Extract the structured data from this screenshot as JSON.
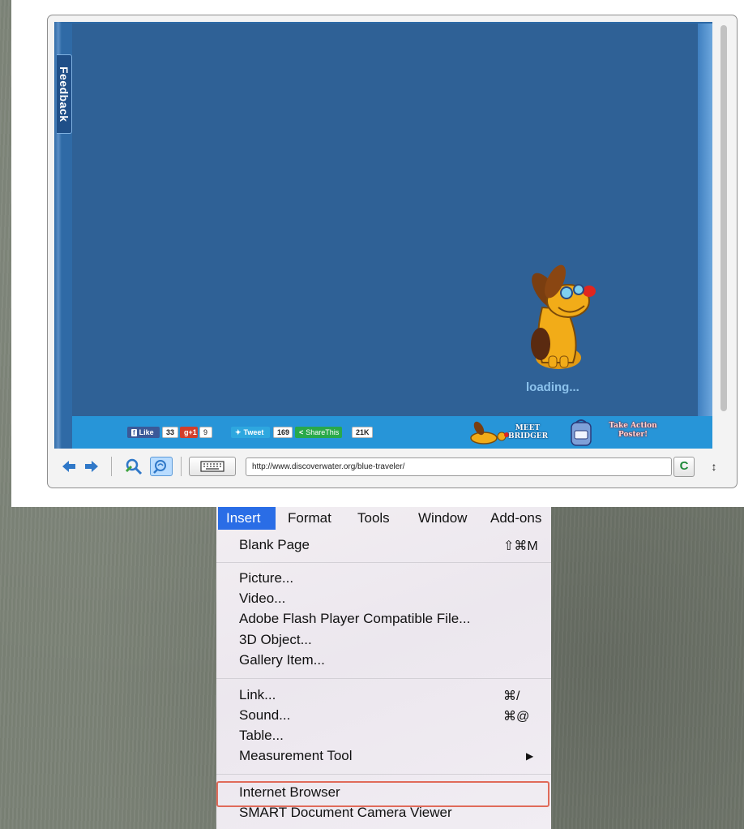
{
  "browser": {
    "feedback_label": "Feedback",
    "loading_text": "loading...",
    "url": "http://www.discoverwater.org/blue-traveler/",
    "refresh_icon": "C",
    "resize_icon": "↕",
    "social": {
      "like_label": "Like",
      "like_count": "33",
      "gplus_label": "g+1",
      "gplus_count": "9",
      "tweet_label": "Tweet",
      "tweet_count": "169",
      "share_label": "ShareThis",
      "share_count": "21K"
    },
    "meet_line1": "MEET",
    "meet_line2": "BRIDGER",
    "action_line1": "Take Action",
    "action_line2": "Poster!"
  },
  "menubar": [
    "Insert",
    "Format",
    "Tools",
    "Window",
    "Add-ons"
  ],
  "menu_items": {
    "blank_page": "Blank Page",
    "blank_page_shortcut": "⇧⌘M",
    "picture": "Picture...",
    "video": "Video...",
    "flash": "Adobe Flash Player Compatible File...",
    "object3d": "3D Object...",
    "gallery": "Gallery Item...",
    "link": "Link...",
    "link_shortcut": "⌘/",
    "sound": "Sound...",
    "sound_shortcut": "⌘@",
    "table": "Table...",
    "measurement": "Measurement Tool",
    "measurement_arrow": "▶",
    "internet_browser": "Internet Browser",
    "smart_camera": "SMART Document Camera Viewer"
  },
  "colors": {
    "menu_selected": "#2a6de6",
    "highlight_outline": "#e06b5a",
    "stage_blue": "#2f6196"
  }
}
